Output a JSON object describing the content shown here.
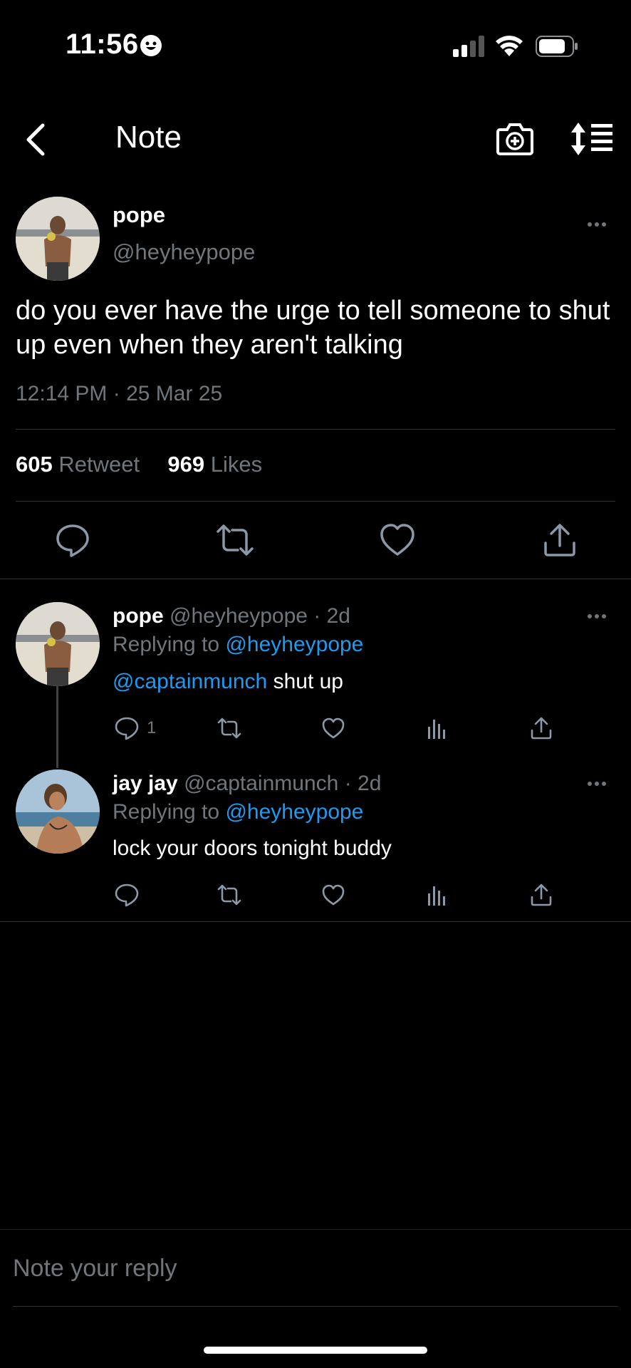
{
  "status_bar": {
    "time": "11:56"
  },
  "header": {
    "title": "Note"
  },
  "main_tweet": {
    "name": "pope",
    "handle": "@heyheypope",
    "text": "do you ever have the urge to tell someone to shut up even when they aren't talking",
    "timestamp": "12:14 PM · 25 Mar 25",
    "retweet_count": "605",
    "retweet_label": "Retweet",
    "like_count": "969",
    "like_label": "Likes"
  },
  "replies": [
    {
      "name": "pope",
      "handle": "@heyheypope",
      "age": "· 2d",
      "replying_prefix": "Replying to",
      "replying_to": "@heyheypope",
      "mention": "@captainmunch",
      "text": " shut up",
      "reply_count": "1"
    },
    {
      "name": "jay jay",
      "handle": "@captainmunch",
      "age": "· 2d",
      "replying_prefix": "Replying to",
      "replying_to": "@heyheypope",
      "text": "lock your doors tonight buddy",
      "reply_count": ""
    }
  ],
  "composer": {
    "placeholder": "Note your reply"
  },
  "colors": {
    "background": "#000000",
    "accent": "#1d9bf0",
    "muted": "#71767b",
    "divider": "#2f3336"
  }
}
